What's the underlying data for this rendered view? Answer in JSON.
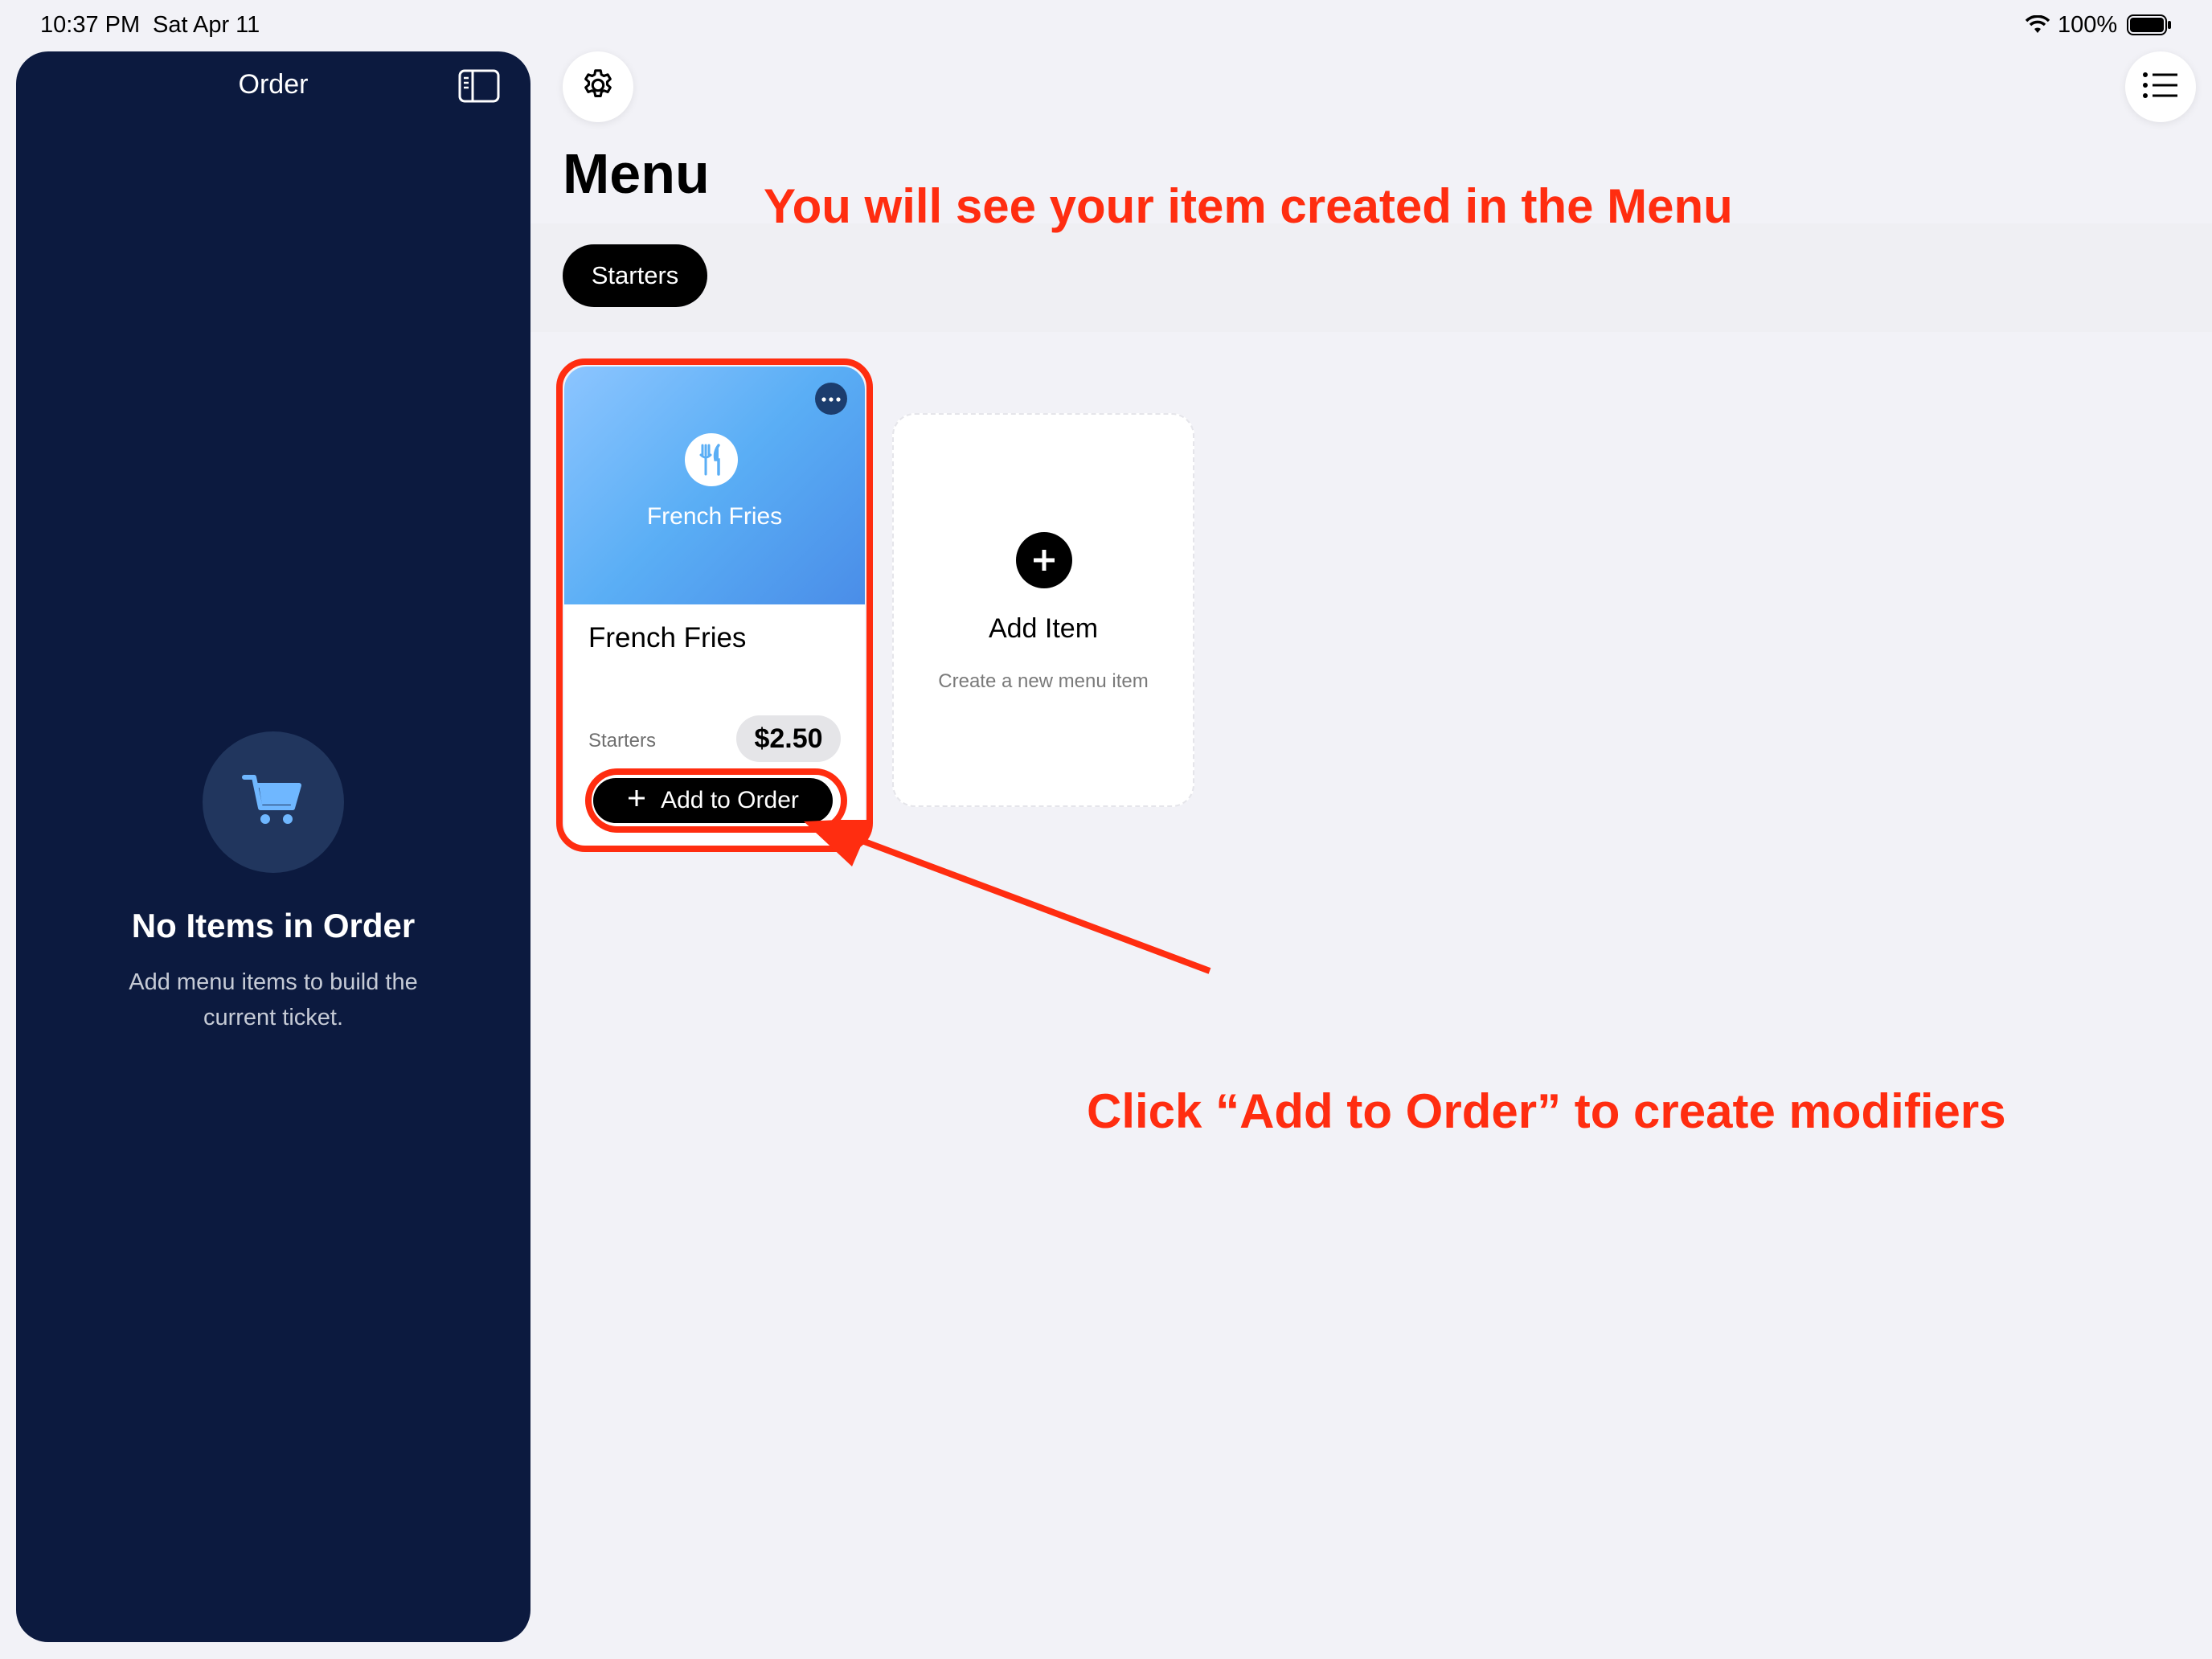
{
  "status_bar": {
    "time": "10:37 PM",
    "date": "Sat Apr 11",
    "battery": "100%"
  },
  "sidebar": {
    "title": "Order",
    "empty_title": "No Items in Order",
    "empty_subtitle": "Add menu items to build the current ticket."
  },
  "main": {
    "title": "Menu",
    "categories": [
      {
        "label": "Starters",
        "selected": true
      }
    ],
    "items": [
      {
        "image_label": "French Fries",
        "name": "French Fries",
        "category": "Starters",
        "price": "$2.50",
        "add_label": "Add to Order"
      }
    ],
    "add_card": {
      "title": "Add Item",
      "subtitle": "Create a new menu item"
    }
  },
  "annotations": {
    "top": "You will see your item created in the Menu",
    "bottom": "Click “Add to Order” to create modifiers"
  },
  "colors": {
    "sidebar_bg": "#0c1a3f",
    "annotation": "#ff2d10",
    "background": "#f2f2f7"
  },
  "icons": [
    "sidebar-toggle-icon",
    "gear-icon",
    "list-icon",
    "fork-knife-icon",
    "ellipsis-icon",
    "plus-icon",
    "cart-icon",
    "wifi-icon",
    "battery-icon"
  ]
}
